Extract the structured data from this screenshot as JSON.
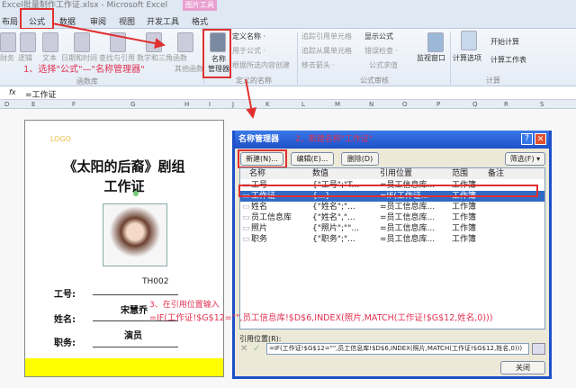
{
  "window": {
    "title": "Excel批量制作工作证.xlsx - Microsoft Excel",
    "context_tab": "图片工具"
  },
  "tabs": [
    "布局",
    "公式",
    "数据",
    "审阅",
    "视图",
    "开发工具",
    "格式"
  ],
  "ribbon": {
    "function_library": {
      "items": [
        "财务",
        "逻辑",
        "文本",
        "日期和时间",
        "查找与引用",
        "数学和三角函数",
        "其他函数"
      ],
      "label": "函数库"
    },
    "defined_names": {
      "name_manager": "名称\n管理器",
      "define_name": "定义名称 ·",
      "use_in_formula": "用于公式 ·",
      "create_from_selection": "根据所选内容创建",
      "label": "定义的名称"
    },
    "formula_auditing": {
      "items": [
        "追踪引用单元格",
        "追踪从属单元格",
        "移去箭头 ·",
        "显示公式",
        "错误检查 ·",
        "公式求值"
      ],
      "label": "公式审核"
    },
    "watch_window": "监视窗口",
    "calculation": {
      "options": "计算选项",
      "calc_now": "开始计算",
      "calc_sheet": "计算工作表",
      "label": "计算"
    }
  },
  "formula_bar": {
    "fx": "fx",
    "value": "=工作证"
  },
  "columns": [
    "D",
    "E",
    "F",
    "G",
    "H",
    "I",
    "J",
    "K",
    "L",
    "M",
    "N",
    "O",
    "P",
    "Q",
    "R",
    "S"
  ],
  "annotations": {
    "step1": "1、选择\"公式\"—\"名称管理器\"",
    "step2": "2、新建名称\"工作证\"",
    "step3": "3、在引用位置输入",
    "step3_formula": "=IF(工作证!$G$12=\"\",员工信息库!$D$6,INDEX(照片,MATCH(工作证!$G$12,姓名,0)))"
  },
  "card": {
    "logo": "LOGO",
    "title1": "《太阳的后裔》剧组",
    "title2": "工作证",
    "fields": [
      {
        "label": "工号:",
        "value": "TH002"
      },
      {
        "label": "姓名:",
        "value": "宋慧乔"
      },
      {
        "label": "职务:",
        "value": "演员"
      }
    ]
  },
  "dialog": {
    "title": "名称管理器",
    "buttons": {
      "new": "新建(N)...",
      "edit": "编辑(E)...",
      "delete": "删除(D)",
      "filter": "筛选(F) ▾",
      "close": "关闭"
    },
    "headers": [
      "名称",
      "数值",
      "引用位置",
      "范围",
      "备注"
    ],
    "rows": [
      {
        "name": "工号",
        "value": "{\"工号\";\"T...",
        "ref": "=员工信息库...",
        "scope": "工作簿"
      },
      {
        "name": "工作证",
        "value": "{...}",
        "ref": "=IF(工作证...",
        "scope": "工作簿",
        "selected": true
      },
      {
        "name": "姓名",
        "value": "{\"姓名\";\"...",
        "ref": "=员工信息库...",
        "scope": "工作簿"
      },
      {
        "name": "员工信息库",
        "value": "{\"姓名\",\"...",
        "ref": "=员工信息库...",
        "scope": "工作簿"
      },
      {
        "name": "照片",
        "value": "{\"照片\";\"\"...",
        "ref": "=员工信息库...",
        "scope": "工作簿"
      },
      {
        "name": "职务",
        "value": "{\"职务\";\"...",
        "ref": "=员工信息库...",
        "scope": "工作簿"
      }
    ],
    "refers_label": "引用位置(R):",
    "refers_value": "=IF(工作证!$G$12=\"\",员工信息库!$D$6,INDEX(照片,MATCH(工作证!$G$12,姓名,0)))"
  },
  "colors": {
    "accent_red": "#e03030",
    "selection": "#316ac5",
    "card_band": "#ffff00"
  }
}
